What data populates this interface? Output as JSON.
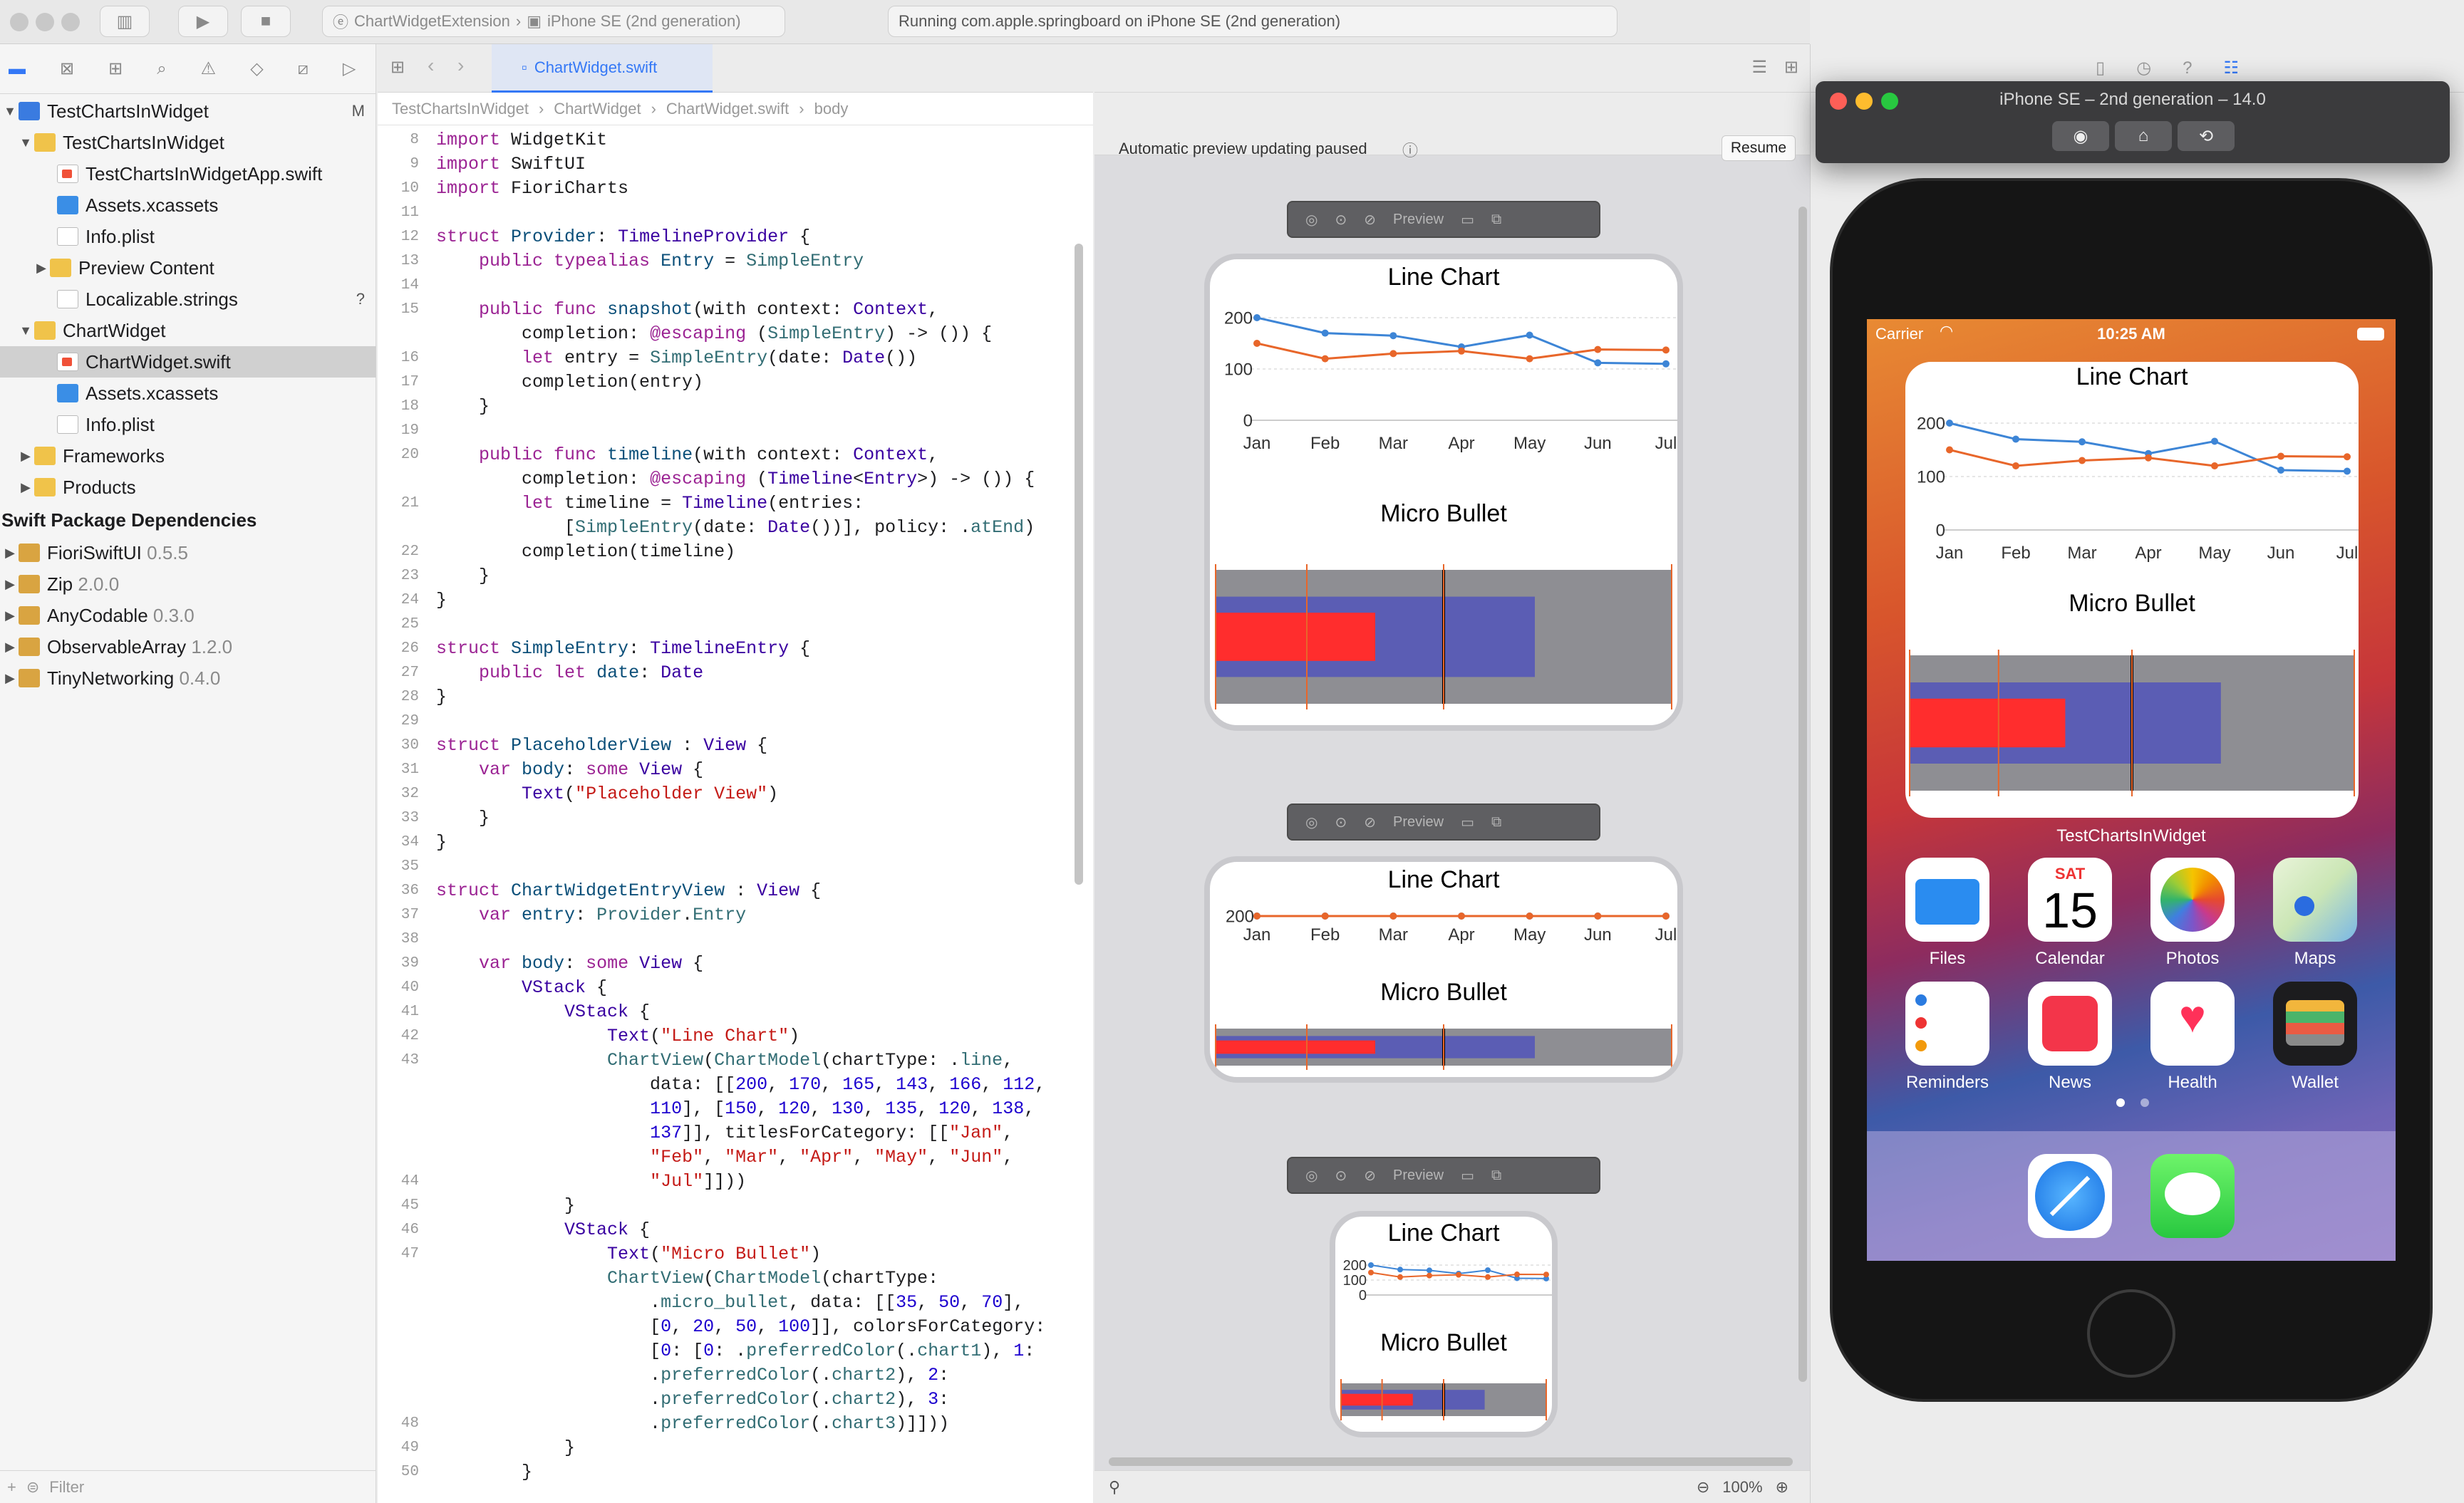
{
  "toolbar": {
    "scheme_target": "ChartWidgetExtension",
    "scheme_device": "iPhone SE (2nd generation)",
    "activity": "Running com.apple.springboard on iPhone SE (2nd generation)"
  },
  "navigator": {
    "filter_placeholder": "Filter",
    "project": {
      "name": "TestChartsInWidget",
      "badge": "M"
    },
    "groups": [
      {
        "name": "TestChartsInWidget",
        "items": [
          "TestChartsInWidgetApp.swift",
          "Assets.xcassets",
          "Info.plist",
          "Preview Content",
          "Localizable.strings"
        ],
        "localizable_badge": "?"
      },
      {
        "name": "ChartWidget",
        "items": [
          "ChartWidget.swift",
          "Assets.xcassets",
          "Info.plist"
        ]
      },
      {
        "name": "Frameworks"
      },
      {
        "name": "Products"
      }
    ],
    "packages_header": "Swift Package Dependencies",
    "packages": [
      {
        "name": "FioriSwiftUI",
        "version": "0.5.5"
      },
      {
        "name": "Zip",
        "version": "2.0.0"
      },
      {
        "name": "AnyCodable",
        "version": "0.3.0"
      },
      {
        "name": "ObservableArray",
        "version": "1.2.0"
      },
      {
        "name": "TinyNetworking",
        "version": "0.4.0"
      }
    ]
  },
  "editor": {
    "tab": "ChartWidget.swift",
    "breadcrumb": [
      "TestChartsInWidget",
      "ChartWidget",
      "ChartWidget.swift",
      "body"
    ],
    "line_numbers": [
      "8",
      "9",
      "10",
      "11",
      "12",
      "13",
      "14",
      "15",
      "",
      "16",
      "17",
      "18",
      "19",
      "20",
      "",
      "21",
      "",
      "22",
      "23",
      "24",
      "25",
      "26",
      "27",
      "28",
      "29",
      "30",
      "31",
      "32",
      "33",
      "34",
      "35",
      "36",
      "37",
      "38",
      "39",
      "40",
      "41",
      "42",
      "43",
      "",
      "",
      "",
      "",
      "44",
      "45",
      "46",
      "47",
      "",
      "",
      "",
      "",
      "",
      "",
      "48",
      "49",
      "50"
    ]
  },
  "canvas": {
    "status": "Automatic preview updating paused",
    "resume_label": "Resume",
    "preview_label": "Preview",
    "zoom": "100%",
    "line_chart_title": "Line Chart",
    "bullet_title": "Micro Bullet",
    "x_labels": [
      "Jan",
      "Feb",
      "Mar",
      "Apr",
      "May",
      "Jun",
      "Jul"
    ],
    "y_labels": [
      "200",
      "100",
      "0"
    ]
  },
  "simulator": {
    "title": "iPhone SE – 2nd generation – 14.0",
    "carrier": "Carrier",
    "time": "10:25 AM",
    "widget_label": "TestChartsInWidget",
    "calendar_day": "SAT",
    "calendar_date": "15",
    "apps": [
      "Files",
      "Calendar",
      "Photos",
      "Maps",
      "Reminders",
      "News",
      "Health",
      "Wallet"
    ],
    "dock": [
      "Safari",
      "Messages"
    ]
  },
  "chart_data": [
    {
      "type": "line",
      "title": "Line Chart",
      "categories": [
        "Jan",
        "Feb",
        "Mar",
        "Apr",
        "May",
        "Jun",
        "Jul"
      ],
      "series": [
        {
          "values": [
            200,
            170,
            165,
            143,
            166,
            112,
            110
          ],
          "color": "#3d85d6"
        },
        {
          "values": [
            150,
            120,
            130,
            135,
            120,
            138,
            137
          ],
          "color": "#e8662a"
        }
      ],
      "ylim": [
        0,
        200
      ],
      "yticks": [
        0,
        100,
        200
      ]
    },
    {
      "type": "bar",
      "title": "Micro Bullet",
      "actual": [
        35,
        50,
        70
      ],
      "reference": [
        0,
        20,
        50,
        100
      ],
      "colors": {
        "actual": "#ff2d2d",
        "target": "#5b5db4",
        "range": "#8e8e93",
        "marker": "#000000",
        "tick": "#e8662a"
      }
    }
  ]
}
